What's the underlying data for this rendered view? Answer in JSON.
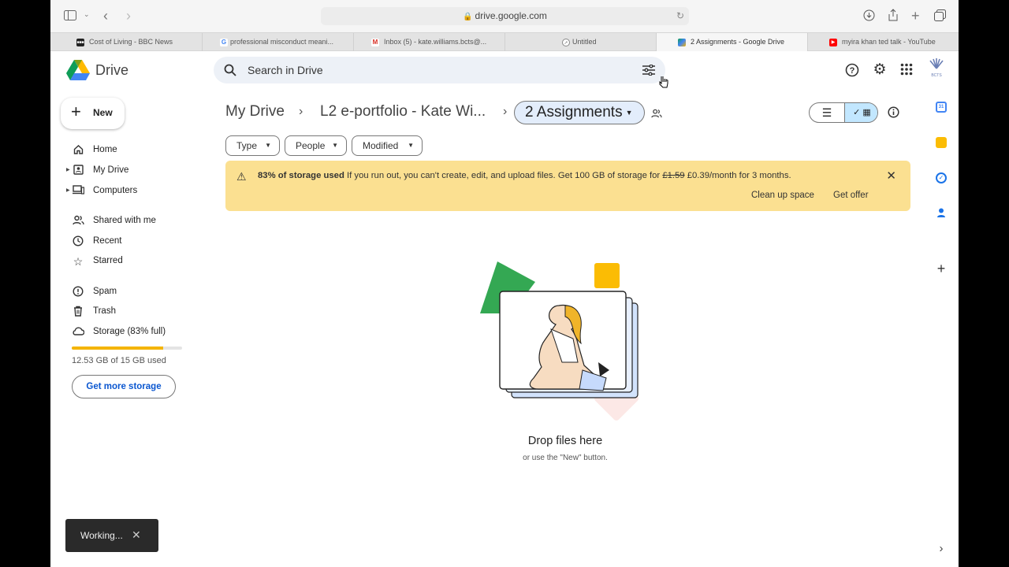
{
  "browser": {
    "url": "drive.google.com",
    "tabs": [
      {
        "label": "Cost of Living - BBC News",
        "favicon": "bbc-icon"
      },
      {
        "label": "professional misconduct meani...",
        "favicon": "google-icon"
      },
      {
        "label": "Inbox (5) - kate.williams.bcts@...",
        "favicon": "gmail-icon"
      },
      {
        "label": "Untitled",
        "favicon": "compass-icon"
      },
      {
        "label": "2 Assignments - Google Drive",
        "favicon": "drive-icon"
      },
      {
        "label": "myira khan ted talk - YouTube",
        "favicon": "youtube-icon"
      }
    ]
  },
  "header": {
    "app_name": "Drive",
    "search_placeholder": "Search in Drive",
    "account_badge": "BCTS"
  },
  "sidebar": {
    "new_label": "New",
    "items": [
      {
        "label": "Home",
        "icon": "home-icon"
      },
      {
        "label": "My Drive",
        "icon": "my-drive-icon"
      },
      {
        "label": "Computers",
        "icon": "computers-icon"
      },
      {
        "label": "Shared with me",
        "icon": "shared-icon"
      },
      {
        "label": "Recent",
        "icon": "clock-icon"
      },
      {
        "label": "Starred",
        "icon": "star-icon"
      },
      {
        "label": "Spam",
        "icon": "spam-icon"
      },
      {
        "label": "Trash",
        "icon": "trash-icon"
      },
      {
        "label": "Storage (83% full)",
        "icon": "cloud-icon"
      }
    ],
    "storage_fraction": 0.83,
    "storage_text": "12.53 GB of 15 GB used",
    "get_more_storage": "Get more storage"
  },
  "main": {
    "breadcrumbs": [
      "My Drive",
      "L2 e-portfolio - Kate Wi...",
      "2 Assignments"
    ],
    "filters": [
      "Type",
      "People",
      "Modified"
    ],
    "banner": {
      "bold": "83% of storage used",
      "message": " If you run out, you can't create, edit, and upload files. Get 100 GB of storage for ",
      "old_price": "£1.59",
      "new_price": " £0.39/month for 3 months.",
      "clean_up": "Clean up space",
      "get_offer": "Get offer"
    },
    "empty_title": "Drop files here",
    "empty_subtitle": "or use the \"New\" button."
  },
  "toast": {
    "text": "Working..."
  },
  "colors": {
    "banner_bg": "#fbe091",
    "storage_fill": "#f4b400",
    "accent_blue": "#0b57d0",
    "selected_view": "#c2e7ff"
  }
}
